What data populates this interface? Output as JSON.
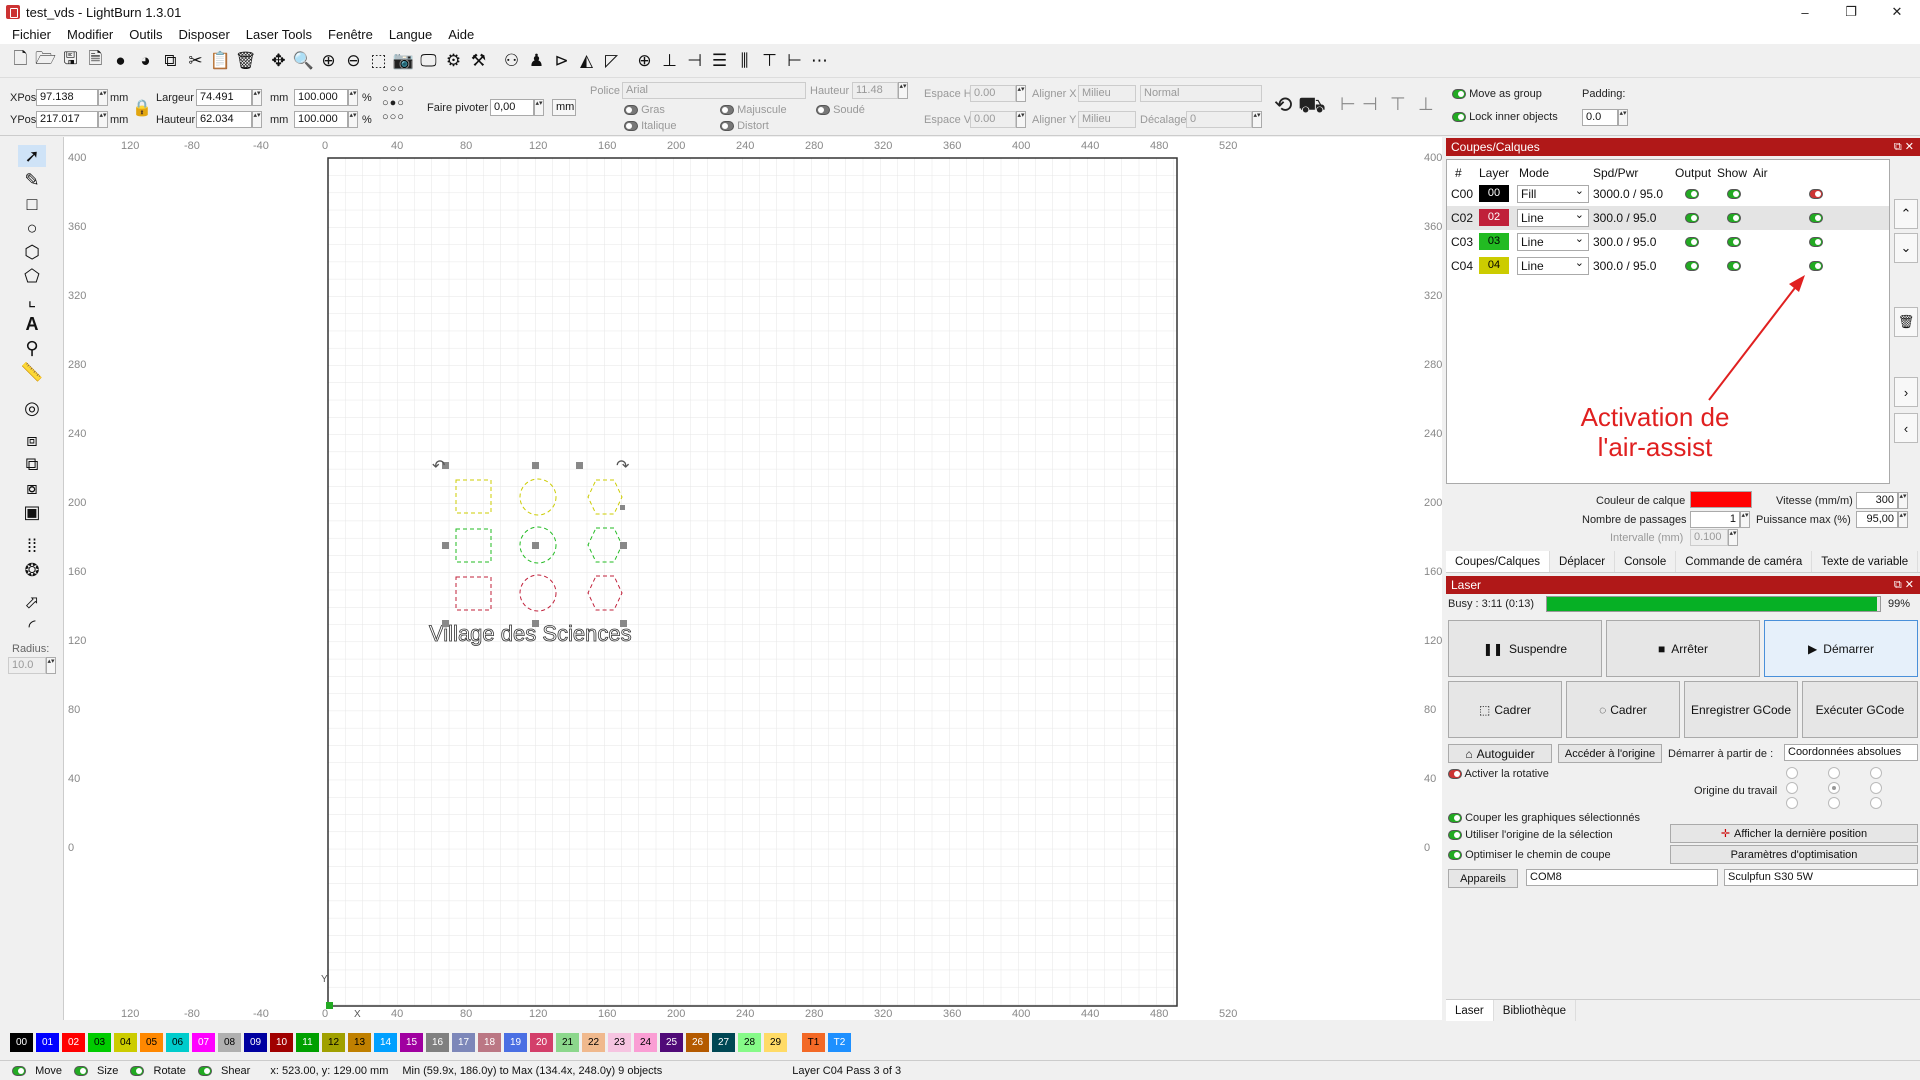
{
  "window": {
    "title": "test_vds - LightBurn 1.3.01",
    "min": "–",
    "max": "❐",
    "close": "✕"
  },
  "menu": [
    "Fichier",
    "Modifier",
    "Outils",
    "Disposer",
    "Laser Tools",
    "Fenêtre",
    "Langue",
    "Aide"
  ],
  "props": {
    "xpos_label": "XPos",
    "xpos": "97.138",
    "ypos_label": "YPos",
    "ypos": "217.017",
    "mm": "mm",
    "width_label": "Largeur",
    "width": "74.491",
    "height_label": "Hauteur",
    "height": "62.034",
    "pct_w": "100.000",
    "pct_h": "100.000",
    "pct": "%",
    "rotate_label": "Faire pivoter",
    "rotate": "0,00",
    "rotate_unit": "mm",
    "font_label": "Police",
    "font": "Arial",
    "fheight_label": "Hauteur",
    "fheight": "11.48",
    "bold": "Gras",
    "italic": "Italique",
    "upper": "Majuscule",
    "distort": "Distort",
    "weld": "Soudé",
    "hspace_label": "Espace H",
    "hspace": "0.00",
    "vspace_label": "Espace V",
    "vspace": "0.00",
    "alignx_label": "Aligner X",
    "alignx": "Milieu",
    "aligny_label": "Aligner Y",
    "aligny": "Milieu",
    "normal": "Normal",
    "offset_label": "Décalage",
    "offset": "0",
    "move_group": "Move as group",
    "lock_inner": "Lock inner objects",
    "padding_label": "Padding:",
    "padding": "0.0"
  },
  "sidebar": {
    "radius_label": "Radius:",
    "radius": "10.0"
  },
  "ruler": {
    "top": [
      "120",
      "-80",
      "-40",
      "0",
      "40",
      "80",
      "120",
      "160",
      "200",
      "240",
      "280",
      "320",
      "360",
      "400",
      "440",
      "480",
      "520"
    ],
    "left": [
      "400",
      "360",
      "320",
      "280",
      "240",
      "200",
      "160",
      "120",
      "80",
      "40",
      "0"
    ],
    "x_axis": "X",
    "y_axis": "Y"
  },
  "canvas": {
    "text": "Village des Sciences"
  },
  "layers": {
    "title": "Coupes/Calques",
    "headers": [
      "#",
      "Layer",
      "Mode",
      "Spd/Pwr",
      "Output",
      "Show",
      "Air"
    ],
    "rows": [
      {
        "id": "C00",
        "num": "00",
        "color": "#000000",
        "mode": "Fill",
        "sp": "3000.0 / 95.0",
        "air": "off"
      },
      {
        "id": "C02",
        "num": "02",
        "color": "#c0203a",
        "mode": "Line",
        "sp": "300.0 / 95.0",
        "air": "on"
      },
      {
        "id": "C03",
        "num": "03",
        "color": "#22bb22",
        "mode": "Line",
        "sp": "300.0 / 95.0",
        "air": "on"
      },
      {
        "id": "C04",
        "num": "04",
        "color": "#cccc00",
        "mode": "Line",
        "sp": "300.0 / 95.0",
        "air": "on"
      }
    ],
    "layer_color_label": "Couleur de calque",
    "layer_color": "#ff0000",
    "speed_label": "Vitesse (mm/m)",
    "speed": "300",
    "passes_label": "Nombre de passages",
    "passes": "1",
    "power_label": "Puissance max (%)",
    "power": "95,00",
    "interval_label": "Intervalle (mm)",
    "interval": "0.100"
  },
  "annotation": "Activation de\nl'air-assist",
  "tabs": [
    "Coupes/Calques",
    "Déplacer",
    "Console",
    "Commande de caméra",
    "Texte de variable"
  ],
  "laser": {
    "title": "Laser",
    "status": "Busy : 3:11 (0:13)",
    "progress": 99,
    "progress_text": "99%",
    "pause": "Suspendre",
    "stop": "Arrêter",
    "start": "Démarrer",
    "frame1": "Cadrer",
    "frame2": "Cadrer",
    "save_gcode": "Enregistrer GCode",
    "run_gcode": "Exécuter GCode",
    "home": "Autoguider",
    "goto_origin": "Accéder à l'origine",
    "start_from_label": "Démarrer à partir de :",
    "start_from": "Coordonnées absolues",
    "rotary": "Activer la rotative",
    "job_origin": "Origine du travail",
    "cut_selected": "Couper les graphiques sélectionnés",
    "use_origin": "Utiliser l'origine de la sélection",
    "show_last": "Afficher la dernière position",
    "optimize": "Optimiser le chemin de coupe",
    "opt_settings": "Paramètres d'optimisation",
    "devices": "Appareils",
    "port": "COM8",
    "device": "Sculpfun S30 5W"
  },
  "bottom_tabs": [
    "Laser",
    "Bibliothèque"
  ],
  "palette": [
    {
      "n": "00",
      "c": "#000000",
      "t": "#fff"
    },
    {
      "n": "01",
      "c": "#0000ff",
      "t": "#fff"
    },
    {
      "n": "02",
      "c": "#ff0000",
      "t": "#fff"
    },
    {
      "n": "03",
      "c": "#00cc00",
      "t": "#000"
    },
    {
      "n": "04",
      "c": "#cccc00",
      "t": "#000"
    },
    {
      "n": "05",
      "c": "#ff8800",
      "t": "#000"
    },
    {
      "n": "06",
      "c": "#00cccc",
      "t": "#000"
    },
    {
      "n": "07",
      "c": "#ff00ff",
      "t": "#fff"
    },
    {
      "n": "08",
      "c": "#b0b0b0",
      "t": "#000"
    },
    {
      "n": "09",
      "c": "#0000a0",
      "t": "#fff"
    },
    {
      "n": "10",
      "c": "#a00000",
      "t": "#fff"
    },
    {
      "n": "11",
      "c": "#00a000",
      "t": "#fff"
    },
    {
      "n": "12",
      "c": "#a0a000",
      "t": "#000"
    },
    {
      "n": "13",
      "c": "#c08000",
      "t": "#000"
    },
    {
      "n": "14",
      "c": "#00a0ff",
      "t": "#fff"
    },
    {
      "n": "15",
      "c": "#a000a0",
      "t": "#fff"
    },
    {
      "n": "16",
      "c": "#808080",
      "t": "#fff"
    },
    {
      "n": "17",
      "c": "#7d87b9",
      "t": "#fff"
    },
    {
      "n": "18",
      "c": "#bb7784",
      "t": "#fff"
    },
    {
      "n": "19",
      "c": "#4a6fe3",
      "t": "#fff"
    },
    {
      "n": "20",
      "c": "#d33f6a",
      "t": "#fff"
    },
    {
      "n": "21",
      "c": "#8cd78c",
      "t": "#000"
    },
    {
      "n": "22",
      "c": "#f0b98d",
      "t": "#000"
    },
    {
      "n": "23",
      "c": "#f6c4e1",
      "t": "#000"
    },
    {
      "n": "24",
      "c": "#fa9ed4",
      "t": "#000"
    },
    {
      "n": "25",
      "c": "#500a78",
      "t": "#fff"
    },
    {
      "n": "26",
      "c": "#b45a00",
      "t": "#fff"
    },
    {
      "n": "27",
      "c": "#004754",
      "t": "#fff"
    },
    {
      "n": "28",
      "c": "#86fa88",
      "t": "#000"
    },
    {
      "n": "29",
      "c": "#ffdb66",
      "t": "#000"
    },
    {
      "n": "T1",
      "c": "#f36926",
      "t": "#000"
    },
    {
      "n": "T2",
      "c": "#1e90ff",
      "t": "#fff"
    }
  ],
  "status": {
    "move": "Move",
    "size": "Size",
    "rotate": "Rotate",
    "shear": "Shear",
    "coords": "x: 523.00, y: 129.00 mm",
    "bounds": "Min (59.9x, 186.0y) to Max (134.4x, 248.0y)  9 objects",
    "layer_info": "Layer C04 Pass 3 of 3"
  }
}
